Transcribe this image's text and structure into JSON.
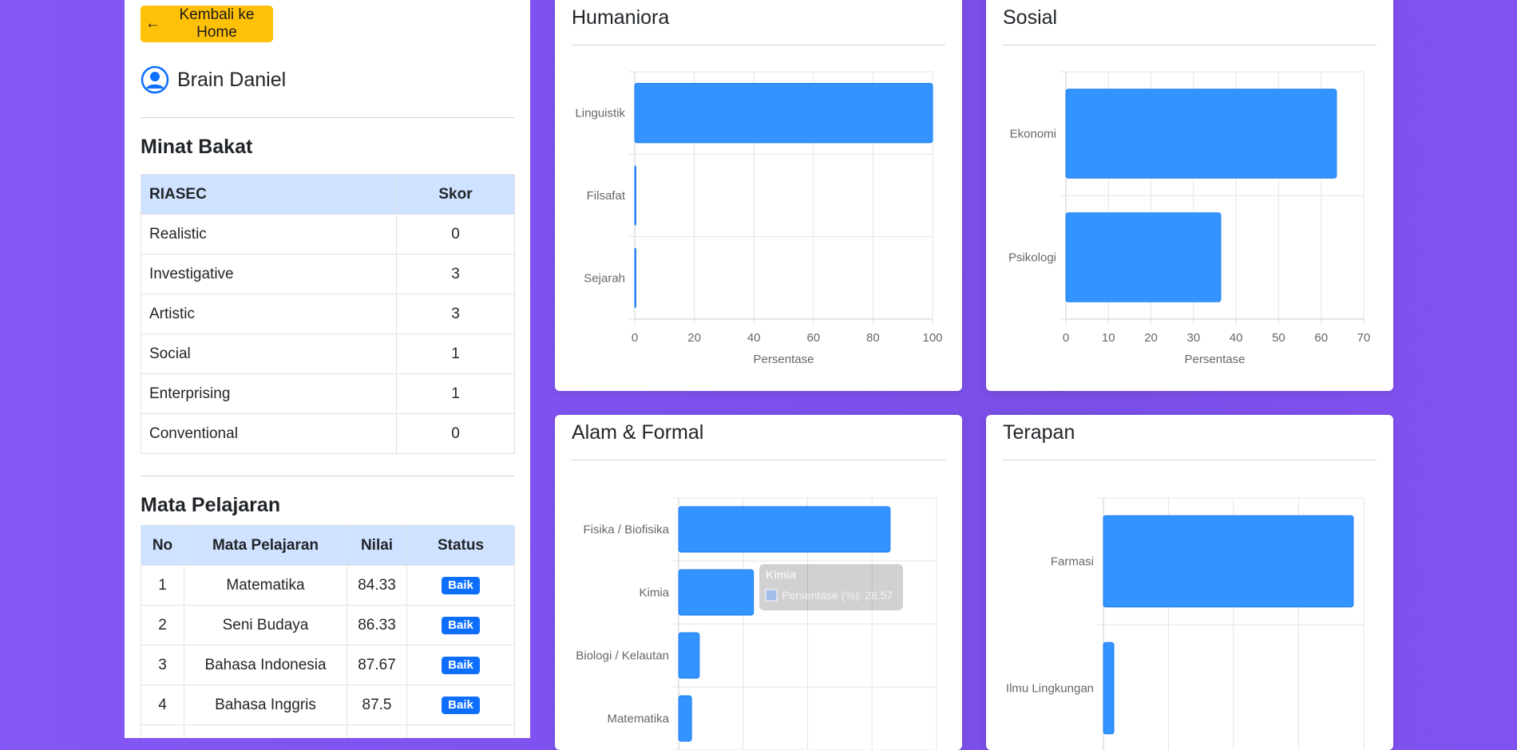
{
  "back_button": {
    "arrow": "←",
    "label": "Kembali ke Home"
  },
  "user": {
    "icon": "user-circle-icon",
    "name": "Brain Daniel"
  },
  "minat_bakat": {
    "title": "Minat Bakat",
    "headers": [
      "RIASEC",
      "Skor"
    ],
    "rows": [
      {
        "label": "Realistic",
        "score": "0"
      },
      {
        "label": "Investigative",
        "score": "3"
      },
      {
        "label": "Artistic",
        "score": "3"
      },
      {
        "label": "Social",
        "score": "1"
      },
      {
        "label": "Enterprising",
        "score": "1"
      },
      {
        "label": "Conventional",
        "score": "0"
      }
    ]
  },
  "mata_pelajaran": {
    "title": "Mata Pelajaran",
    "headers": [
      "No",
      "Mata Pelajaran",
      "Nilai",
      "Status"
    ],
    "rows": [
      {
        "no": "1",
        "name": "Matematika",
        "nilai": "84.33",
        "status": "Baik"
      },
      {
        "no": "2",
        "name": "Seni Budaya",
        "nilai": "86.33",
        "status": "Baik"
      },
      {
        "no": "3",
        "name": "Bahasa Indonesia",
        "nilai": "87.67",
        "status": "Baik"
      },
      {
        "no": "4",
        "name": "Bahasa Inggris",
        "nilai": "87.5",
        "status": "Baik"
      }
    ]
  },
  "colors": {
    "bar": "#3393ff",
    "bar_border": "#1e7ef0",
    "button": "#ffc107",
    "badge": "#0d6efd",
    "table_header": "#cfe2ff"
  },
  "chart_data": [
    {
      "type": "bar",
      "orientation": "horizontal",
      "title": "Humaniora",
      "categories": [
        "Linguistik",
        "Filsafat",
        "Sejarah"
      ],
      "values": [
        100,
        0.4,
        0.4
      ],
      "xlabel": "Persentase",
      "xlim": [
        0,
        100
      ],
      "xticks": [
        "0",
        "20",
        "40",
        "60",
        "80",
        "100"
      ],
      "grid": true
    },
    {
      "type": "bar",
      "orientation": "horizontal",
      "title": "Sosial",
      "categories": [
        "Ekonomi",
        "Psikologi"
      ],
      "values": [
        63.6,
        36.4
      ],
      "xlabel": "Persentase",
      "xlim": [
        0,
        70
      ],
      "xticks": [
        "0",
        "10",
        "20",
        "30",
        "40",
        "50",
        "60",
        "70"
      ],
      "grid": true
    },
    {
      "type": "bar",
      "orientation": "horizontal",
      "title": "Alam & Formal",
      "categories": [
        "Fisika / Biofisika",
        "Kimia",
        "Biologi / Kelautan",
        "Matematika"
      ],
      "values": [
        82,
        29,
        8,
        5
      ],
      "grid": true,
      "tooltip": {
        "title": "Kimia",
        "label": "Persentase (%): 28.57"
      }
    },
    {
      "type": "bar",
      "orientation": "horizontal",
      "title": "Terapan",
      "categories": [
        "Farmasi",
        "Ilmu Lingkungan"
      ],
      "values": [
        96,
        4
      ],
      "grid": true
    }
  ]
}
